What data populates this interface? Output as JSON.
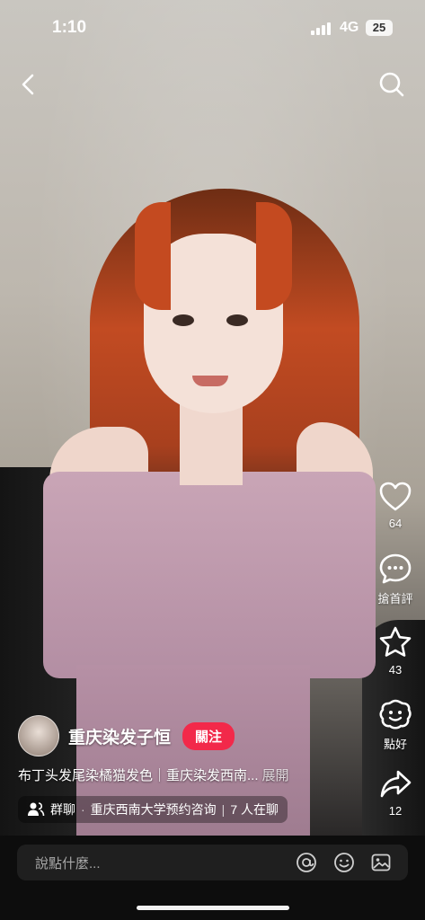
{
  "status_bar": {
    "time": "1:10",
    "network": "4G",
    "battery": "25"
  },
  "header": {
    "back_icon": "chevron-left-icon",
    "search_icon": "search-icon"
  },
  "actions": {
    "like": {
      "icon": "heart-icon",
      "count": "64"
    },
    "comment": {
      "icon": "comment-icon",
      "label": "搶首評"
    },
    "favorite": {
      "icon": "star-icon",
      "count": "43"
    },
    "react": {
      "icon": "reaction-icon",
      "label": "點好"
    },
    "share": {
      "icon": "share-icon",
      "count": "12"
    }
  },
  "author": {
    "name": "重庆染发子恒",
    "follow_label": "關注"
  },
  "caption": {
    "text": "布丁头发尾染橘猫发色｜重庆染发西南...",
    "more": "展開"
  },
  "group_chat": {
    "label": "群聊",
    "title": "重庆西南大学预约咨询",
    "count": "7 人在聊"
  },
  "comment_bar": {
    "placeholder": "說點什麼..."
  },
  "colors": {
    "follow": "#f2294a",
    "bottom_bar": "#0d0d0d"
  }
}
